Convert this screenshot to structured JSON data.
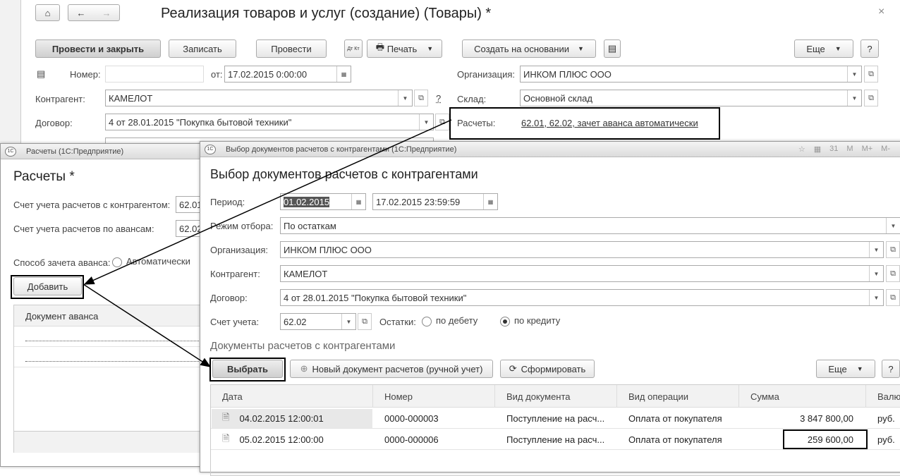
{
  "main": {
    "title": "Реализация товаров и услуг (создание) (Товары) *",
    "close": "×",
    "toolbar": {
      "post_close": "Провести и закрыть",
      "save": "Записать",
      "post": "Провести",
      "dtkt": "Дт Кт",
      "print": "Печать",
      "create_based": "Создать на основании",
      "more": "Еще",
      "help": "?"
    },
    "number_label": "Номер:",
    "number_value": "",
    "date_label": "от:",
    "date_value": "17.02.2015  0:00:00",
    "org_label": "Организация:",
    "org_value": "ИНКОМ ПЛЮС ООО",
    "contractor_label": "Контрагент:",
    "contractor_value": "КАМЕЛОТ",
    "question": "?",
    "warehouse_label": "Склад:",
    "warehouse_value": "Основной склад",
    "contract_label": "Договор:",
    "contract_value": "4 от 28.01.2015 \"Покупка бытовой техники\"",
    "settlements_label": "Расчеты:",
    "settlements_link": "62.01, 62.02, зачет аванса автоматически"
  },
  "left": {
    "window_title": "Расчеты  (1С:Предприятие)",
    "title": "Расчеты *",
    "acc_label": "Счет учета расчетов с контрагентом:",
    "acc_value": "62.01",
    "adv_label": "Счет учета расчетов по авансам:",
    "adv_value": "62.02",
    "method_label": "Способ зачета аванса:",
    "method_option": "Автоматически",
    "add": "Добавить",
    "col": "Документ аванса"
  },
  "right": {
    "window_title": "Выбор документов расчетов с контрагентами  (1С:Предприятие)",
    "title": "Выбор документов расчетов с контрагентами",
    "wt_icons": [
      "М",
      "М+",
      "М-"
    ],
    "period_label": "Период:",
    "period_from": "01.02.2015",
    "period_to": "17.02.2015 23:59:59",
    "mode_label": "Режим отбора:",
    "mode_value": "По остаткам",
    "org_label": "Организация:",
    "org_value": "ИНКОМ ПЛЮС ООО",
    "contractor_label": "Контрагент:",
    "contractor_value": "КАМЕЛОТ",
    "contract_label": "Договор:",
    "contract_value": "4 от 28.01.2015 \"Покупка бытовой техники\"",
    "account_label": "Счет учета:",
    "account_value": "62.02",
    "balance_label": "Остатки:",
    "debit": "по дебету",
    "credit": "по кредиту",
    "section": "Документы расчетов с контрагентами",
    "select": "Выбрать",
    "new_doc": "Новый документ расчетов (ручной учет)",
    "generate": "Сформировать",
    "more": "Еще",
    "help": "?",
    "columns": [
      "Дата",
      "Номер",
      "Вид документа",
      "Вид операции",
      "Сумма",
      "Валю"
    ],
    "rows": [
      [
        "04.02.2015 12:00:01",
        "0000-000003",
        "Поступление на расч...",
        "Оплата от покупателя",
        "3 847 800,00",
        "руб."
      ],
      [
        "05.02.2015 12:00:00",
        "0000-000006",
        "Поступление на расч...",
        "Оплата от покупателя",
        "259 600,00",
        "руб."
      ]
    ]
  }
}
